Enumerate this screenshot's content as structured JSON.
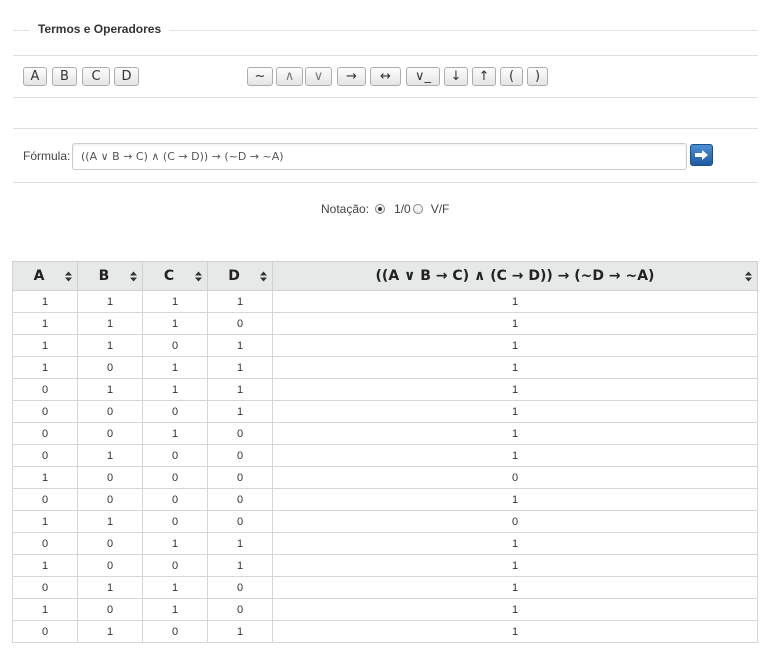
{
  "section_title": "Termos e Operadores",
  "terms": [
    "A",
    "B",
    "C",
    "D"
  ],
  "operators": [
    "~",
    "∧",
    "∨",
    "→",
    "↔",
    "∨_",
    "↓",
    "↑",
    "(",
    ")"
  ],
  "formula": {
    "label": "Fórmula:",
    "value": "((A ∨ B → C) ∧ (C → D)) → (~D → ~A)"
  },
  "notation": {
    "label": "Notação:",
    "options": [
      "1/0",
      "V/F"
    ],
    "selected": "1/0"
  },
  "table": {
    "headers": [
      "A",
      "B",
      "C",
      "D",
      "((A ∨ B → C) ∧ (C → D)) → (~D → ~A)"
    ],
    "rows": [
      [
        "1",
        "1",
        "1",
        "1",
        "1"
      ],
      [
        "1",
        "1",
        "1",
        "0",
        "1"
      ],
      [
        "1",
        "1",
        "0",
        "1",
        "1"
      ],
      [
        "1",
        "0",
        "1",
        "1",
        "1"
      ],
      [
        "0",
        "1",
        "1",
        "1",
        "1"
      ],
      [
        "0",
        "0",
        "0",
        "1",
        "1"
      ],
      [
        "0",
        "0",
        "1",
        "0",
        "1"
      ],
      [
        "0",
        "1",
        "0",
        "0",
        "1"
      ],
      [
        "1",
        "0",
        "0",
        "0",
        "0"
      ],
      [
        "0",
        "0",
        "0",
        "0",
        "1"
      ],
      [
        "1",
        "1",
        "0",
        "0",
        "0"
      ],
      [
        "0",
        "0",
        "1",
        "1",
        "1"
      ],
      [
        "1",
        "0",
        "0",
        "1",
        "1"
      ],
      [
        "0",
        "1",
        "1",
        "0",
        "1"
      ],
      [
        "1",
        "0",
        "1",
        "0",
        "1"
      ],
      [
        "0",
        "1",
        "0",
        "1",
        "1"
      ]
    ]
  }
}
